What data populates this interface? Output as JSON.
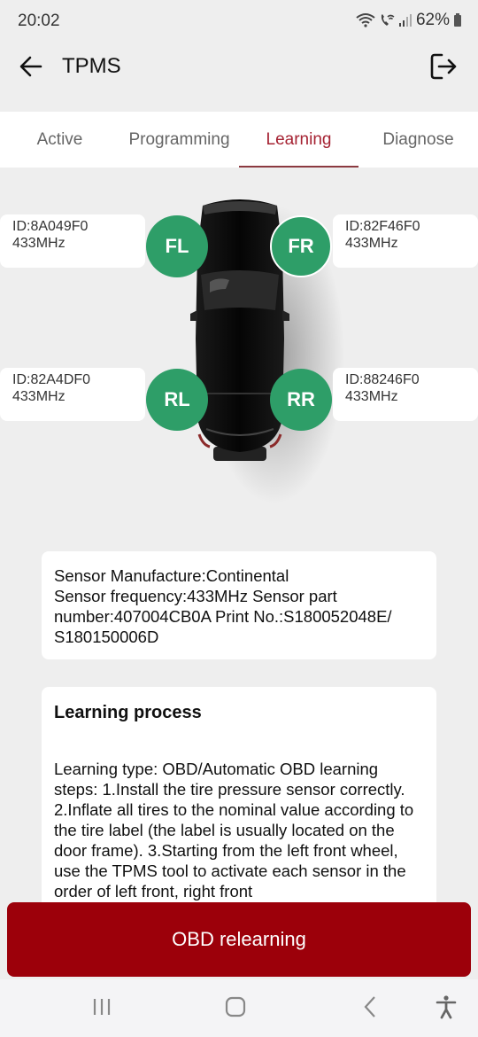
{
  "status_bar": {
    "time": "20:02",
    "battery": "62%",
    "icons": [
      "wifi-icon",
      "wifi-calling-icon",
      "signal-icon",
      "battery-icon"
    ]
  },
  "app_bar": {
    "title": "TPMS",
    "back_icon": "arrow-left-icon",
    "exit_icon": "logout-icon"
  },
  "tabs": [
    {
      "label": "Active",
      "active": false
    },
    {
      "label": "Programming",
      "active": false
    },
    {
      "label": "Learning",
      "active": true
    },
    {
      "label": "Diagnose",
      "active": false
    }
  ],
  "wheels": {
    "fl": {
      "badge": "FL",
      "id": "ID:8A049F0",
      "freq": "433MHz"
    },
    "fr": {
      "badge": "FR",
      "id": "ID:82F46F0",
      "freq": "433MHz"
    },
    "rl": {
      "badge": "RL",
      "id": "ID:82A4DF0",
      "freq": "433MHz"
    },
    "rr": {
      "badge": "RR",
      "id": "ID:88246F0",
      "freq": "433MHz"
    }
  },
  "sensor_info": {
    "text": "Sensor Manufacture:Continental Sensor frequency:433MHz Sensor part number:407004CB0A Print No.:S180052048E/ S180150006D",
    "line1": "Sensor Manufacture:Continental",
    "line2": "Sensor frequency:433MHz Sensor part number:407004CB0A Print No.:S180052048E/ S180150006D"
  },
  "learning_process": {
    "title": "Learning process",
    "text": "Learning type: OBD/Automatic OBD learning steps:  1.Install the tire pressure sensor correctly. 2.Inflate all tires to the nominal value according to the tire label (the label is usually located on the door frame). 3.Starting from the left front wheel, use the TPMS tool to activate each sensor in the order of left front, right front"
  },
  "primary_action": {
    "label": "OBD relearning"
  },
  "colors": {
    "accent": "#a52232",
    "button": "#9c000a",
    "wheel_badge": "#2e9e68"
  },
  "nav_bar": {
    "items": [
      "recent-apps-icon",
      "home-icon",
      "back-icon",
      "accessibility-icon"
    ]
  }
}
